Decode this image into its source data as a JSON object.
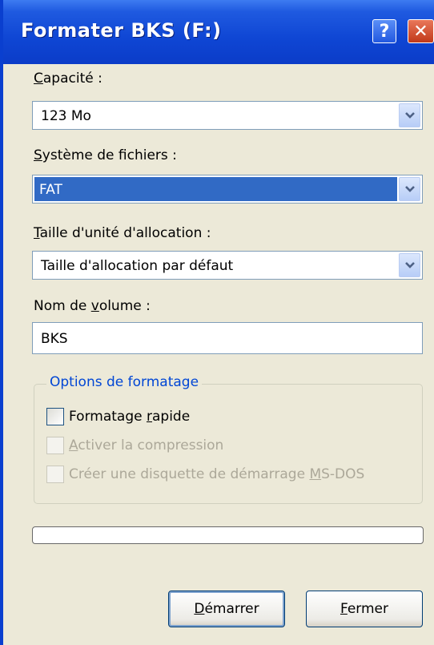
{
  "window": {
    "title": "Formater BKS (F:)",
    "help_glyph": "?",
    "close_glyph": "✕"
  },
  "capacity": {
    "label_ul": "C",
    "label_rest": "apacité :",
    "value": "123 Mo"
  },
  "filesystem": {
    "label_ul": "S",
    "label_rest": "ystème de fichiers :",
    "value": "FAT"
  },
  "allocation": {
    "label_ul": "T",
    "label_rest": "aille d'unité d'allocation :",
    "value": "Taille d'allocation par défaut"
  },
  "volume": {
    "label_pre": "Nom de ",
    "label_ul": "v",
    "label_rest": "olume :",
    "value": "BKS"
  },
  "options": {
    "title": "Options de formatage",
    "quick": {
      "pre": "Formatage ",
      "ul": "r",
      "rest": "apide",
      "checked": false,
      "enabled": true
    },
    "compress": {
      "pre": "",
      "ul": "A",
      "rest": "ctiver la compression",
      "checked": false,
      "enabled": false
    },
    "msdos": {
      "pre": "Créer une disquette de démarrage ",
      "ul": "M",
      "rest": "S-DOS",
      "checked": false,
      "enabled": false
    }
  },
  "progress": {
    "value": 0
  },
  "buttons": {
    "start": {
      "ul": "D",
      "rest": "émarrer"
    },
    "close": {
      "ul": "F",
      "rest": "ermer"
    }
  }
}
